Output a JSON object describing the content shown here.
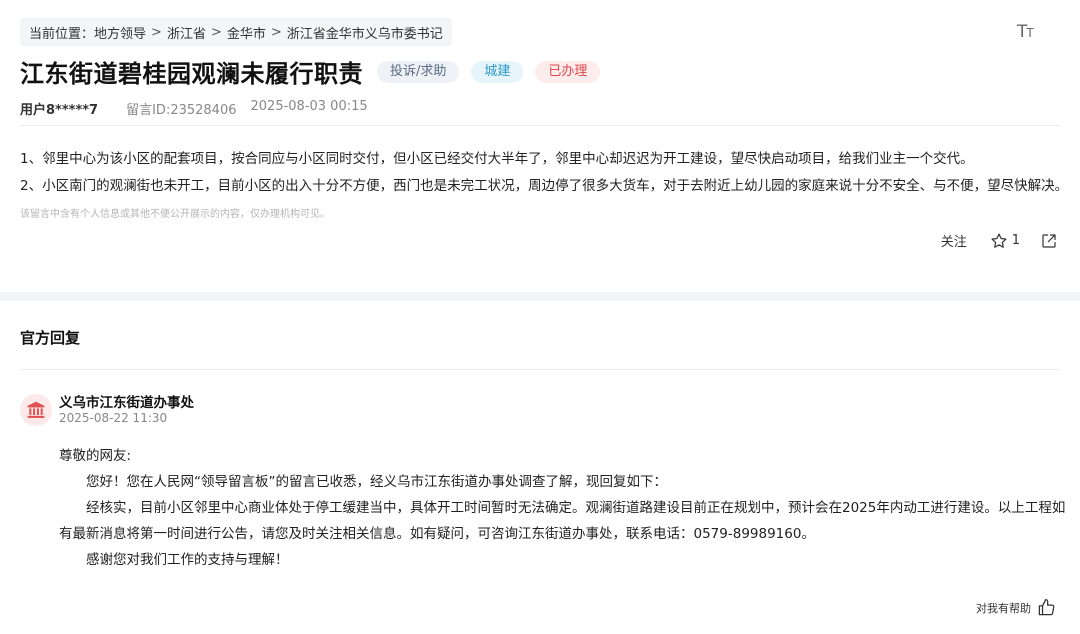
{
  "breadcrumb": {
    "prefix": "当前位置：",
    "items": [
      "地方领导",
      "浙江省",
      "金华市",
      "浙江省金华市义乌市委书记"
    ],
    "separator": ">"
  },
  "font_toggle": {
    "big": "T",
    "small": "T"
  },
  "message": {
    "title": "江东街道碧桂园观澜未履行职责",
    "tags": {
      "type": "投诉/求助",
      "category": "城建",
      "status": "已办理"
    },
    "user": "用户8*****7",
    "id": "留言ID:23528406",
    "time": "2025-08-03 00:15",
    "paragraphs": [
      "1、邻里中心为该小区的配套项目，按合同应与小区同时交付，但小区已经交付大半年了，邻里中心却迟迟为开工建设，望尽快启动项目，给我们业主一个交代。",
      "2、小区南门的观澜街也未开工，目前小区的出入十分不方便，西门也是未完工状况，周边停了很多大货车，对于去附近上幼儿园的家庭来说十分不安全、与不便，望尽快解决。"
    ],
    "privacy_note": "该留言中含有个人信息或其他不便公开展示的内容，仅办理机构可见。",
    "actions": {
      "follow": "关注",
      "star_count": "1"
    }
  },
  "official_reply": {
    "section_title": "官方回复",
    "org_name": "义乌市江东街道办事处",
    "date": "2025-08-22 11:30",
    "greeting": "尊敬的网友:",
    "paragraphs": [
      "您好！您在人民网“领导留言板”的留言已收悉，经义乌市江东街道办事处调查了解，现回复如下：",
      "经核实，目前小区邻里中心商业体处于停工缓建当中，具体开工时间暂时无法确定。观澜街道路建设目前正在规划中，预计会在2025年内动工进行建设。以上工程如有最新消息将第一时间进行公告，请您及时关注相关信息。如有疑问，可咨询江东街道办事处，联系电话：0579-89989160。",
      "感谢您对我们工作的支持与理解！"
    ],
    "helpful_label": "对我有帮助"
  },
  "colors": {
    "status": "#e0474c",
    "category": "#2f97c9",
    "org_icon": "#e05252"
  }
}
